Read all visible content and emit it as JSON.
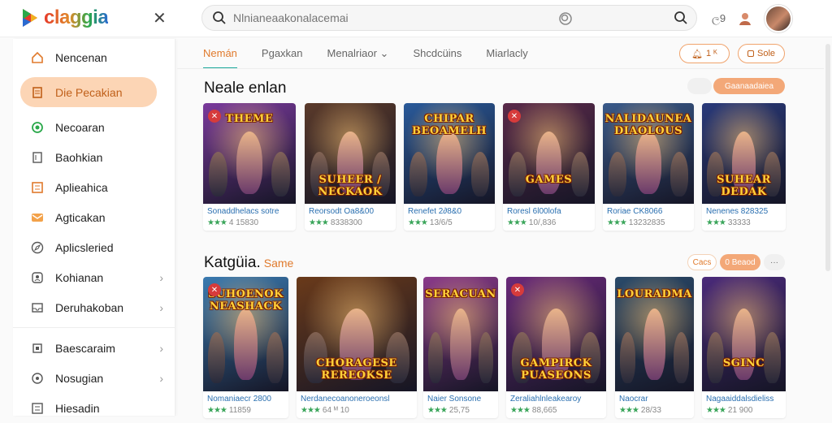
{
  "app": {
    "logo_text": "claggia"
  },
  "search": {
    "placeholder": "Nlnianeaakonalacemai"
  },
  "top_right": {
    "item1": "ﺭ",
    "item1_label": "ල9",
    "item2_label": "☺"
  },
  "sidebar": {
    "items": [
      {
        "label": "Nencenan",
        "icon": "home-icon"
      },
      {
        "label": "Die Pecakian",
        "icon": "document-icon",
        "active": true
      },
      {
        "label": "Necoaran",
        "icon": "target-icon"
      },
      {
        "label": "Baohkian",
        "icon": "book-icon"
      },
      {
        "label": "Aplieahica",
        "icon": "grid-icon"
      },
      {
        "label": "Agticakan",
        "icon": "mail-icon"
      },
      {
        "label": "Aplicsleried",
        "icon": "compass-icon"
      },
      {
        "label": "Kohianan",
        "icon": "user-icon",
        "chevron": true
      },
      {
        "label": "Deruhakoban",
        "icon": "inbox-icon",
        "chevron": true
      },
      {
        "label": "Baescaraim",
        "icon": "square-icon",
        "chevron": true
      },
      {
        "label": "Nosugian",
        "icon": "circle-icon",
        "chevron": true
      },
      {
        "label": "Hiesadin",
        "icon": "list-icon"
      }
    ]
  },
  "tabs": [
    {
      "label": "Nemán",
      "active": true
    },
    {
      "label": "Pgaxkan"
    },
    {
      "label": "Menalriaor ⌄"
    },
    {
      "label": "Shcdcüins"
    },
    {
      "label": "Miarlacly"
    }
  ],
  "header_buttons": {
    "btn1": "1 ᴷ",
    "btn2": "Sole"
  },
  "section1": {
    "title": "Neale enlan",
    "action": "Gaanaadaiea"
  },
  "section2": {
    "title": "Katgüia.",
    "subtitle": "Same",
    "btn_a": "Cacs",
    "btn_b": "0 Beaod",
    "more": "···"
  },
  "row1": [
    {
      "art": "THEME",
      "name": "Sonaddhelacs sotre",
      "rating": "★★★ 4 15830",
      "bg": "#7a3a9c"
    },
    {
      "art": "SUHEER / NECKAOK",
      "name": "Reorsodt Oa8&00",
      "rating": "★★★ 8338300",
      "bg": "#5a3a2a"
    },
    {
      "art": "CHIPAR BEOAMELH",
      "name": "Renefet 2∂8&0",
      "rating": "★★★ 13/6/5",
      "bg": "#2a5a9a"
    },
    {
      "art": "GAMES",
      "name": "Roresl 6l00lofa",
      "rating": "★★★ 10/,836",
      "bg": "#5a2a4a"
    },
    {
      "art": "NALIDAUNEA DIAOLOUS",
      "name": "Roriae CK8066",
      "rating": "★★★ 13232835",
      "bg": "#3a5a8a"
    },
    {
      "art": "SUHEAR DEDAK",
      "name": "Nenenes 828325",
      "rating": "★★★ 33333",
      "bg": "#2a3a7a"
    }
  ],
  "row2": [
    {
      "art": "SUHOENOK NEASHACK",
      "name": "Nomaniaecr 2800",
      "rating": "★★★ 11859",
      "bg": "#3a7ab0"
    },
    {
      "art": "CHORAGESE REREOKSE",
      "name": "Nerdanecoanoneroeonsl",
      "rating": "★★★ 64 ᴹ 10",
      "bg": "#6a3a1a"
    },
    {
      "art": "SERACUAN",
      "name": "Naier Sonsone",
      "rating": "★★★ 25,75",
      "bg": "#8a3a8a"
    },
    {
      "art": "GAMPIRCK PUASEONS",
      "name": "Zeraliahlnleakearoy",
      "rating": "★★★ 88,665",
      "bg": "#6a2a7a"
    },
    {
      "art": "LOURADMA",
      "name": "Naocrar",
      "rating": "★★★ 28/33",
      "bg": "#2a4a6a"
    },
    {
      "art": "SGINC",
      "name": "Nagaaiddalsdieliss",
      "rating": "★★★ 21 900",
      "bg": "#4a2a7a"
    }
  ]
}
